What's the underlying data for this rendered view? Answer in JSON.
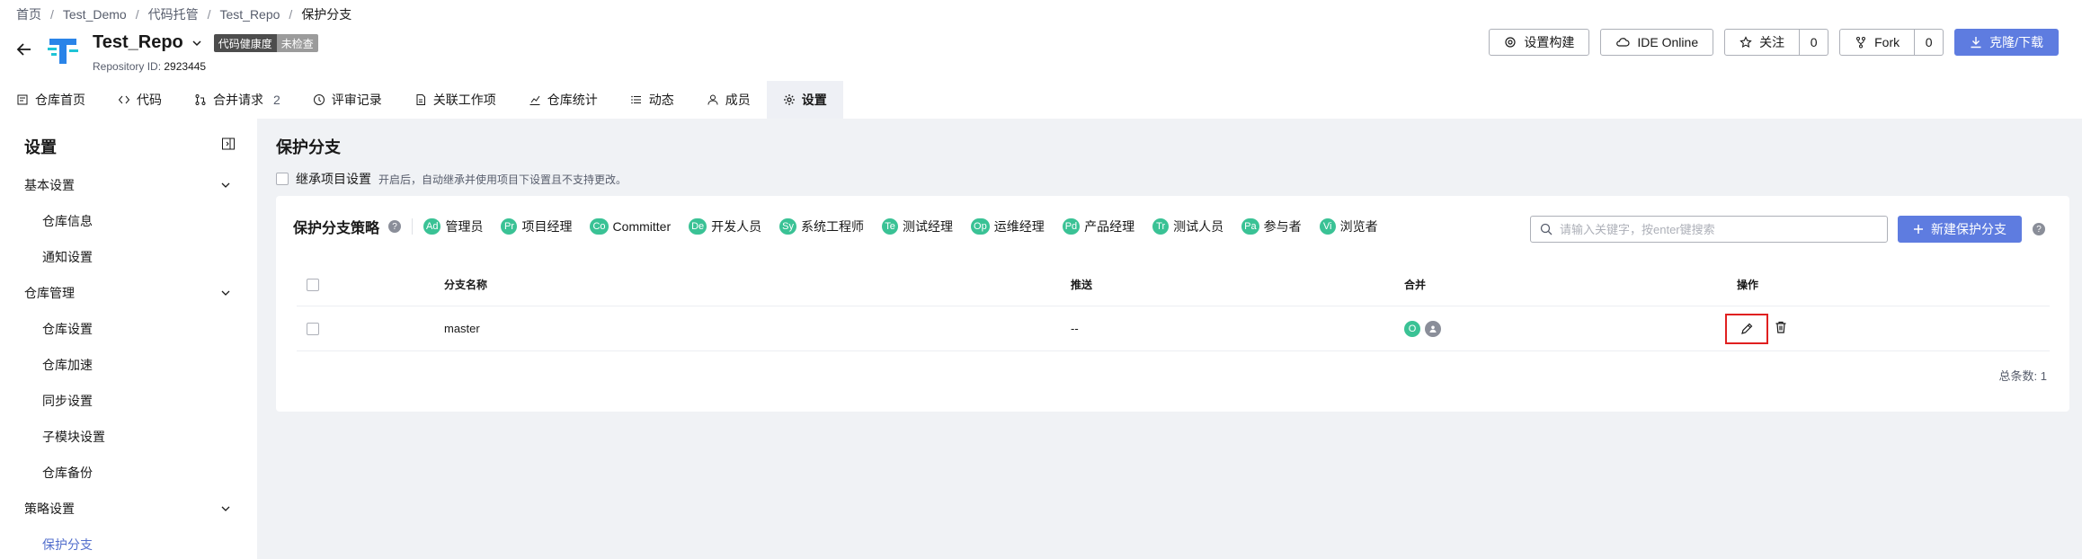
{
  "breadcrumb": [
    "首页",
    "Test_Demo",
    "代码托管",
    "Test_Repo",
    "保护分支"
  ],
  "repo": {
    "name": "Test_Repo",
    "health_label": "代码健康度",
    "health_status": "未检查",
    "id_label": "Repository ID:",
    "id_value": "2923445"
  },
  "actions": {
    "settings_build": "设置构建",
    "ide_online": "IDE Online",
    "follow": "关注",
    "follow_count": "0",
    "fork": "Fork",
    "fork_count": "0",
    "clone": "克隆/下载"
  },
  "tabs": [
    {
      "label": "仓库首页",
      "icon": "file-icon"
    },
    {
      "label": "代码",
      "icon": "code-icon"
    },
    {
      "label": "合并请求",
      "icon": "merge-request-icon",
      "badge": "2"
    },
    {
      "label": "评审记录",
      "icon": "review-icon"
    },
    {
      "label": "关联工作项",
      "icon": "link-work-item-icon"
    },
    {
      "label": "仓库统计",
      "icon": "stats-icon"
    },
    {
      "label": "动态",
      "icon": "activity-icon"
    },
    {
      "label": "成员",
      "icon": "member-icon"
    },
    {
      "label": "设置",
      "icon": "gear-icon",
      "active": true
    }
  ],
  "sidebar": {
    "title": "设置",
    "groups": [
      {
        "label": "基本设置",
        "items": [
          "仓库信息",
          "通知设置"
        ]
      },
      {
        "label": "仓库管理",
        "items": [
          "仓库设置",
          "仓库加速",
          "同步设置",
          "子模块设置",
          "仓库备份"
        ]
      },
      {
        "label": "策略设置",
        "items": [
          "保护分支"
        ]
      }
    ],
    "active_item": "保护分支"
  },
  "main": {
    "heading": "保护分支",
    "inherit_label": "继承项目设置",
    "inherit_desc": "开启后，自动继承并使用项目下设置且不支持更改。",
    "policy_title": "保护分支策略",
    "roles": [
      {
        "abbr": "Ad",
        "name": "管理员"
      },
      {
        "abbr": "Pr",
        "name": "项目经理"
      },
      {
        "abbr": "Co",
        "name": "Committer"
      },
      {
        "abbr": "De",
        "name": "开发人员"
      },
      {
        "abbr": "Sy",
        "name": "系统工程师"
      },
      {
        "abbr": "Te",
        "name": "测试经理"
      },
      {
        "abbr": "Op",
        "name": "运维经理"
      },
      {
        "abbr": "Pd",
        "name": "产品经理"
      },
      {
        "abbr": "Tr",
        "name": "测试人员"
      },
      {
        "abbr": "Pa",
        "name": "参与者"
      },
      {
        "abbr": "Vi",
        "name": "浏览者"
      }
    ],
    "search_placeholder": "请输入关键字，按enter键搜索",
    "new_button": "新建保护分支",
    "columns": {
      "name": "分支名称",
      "push": "推送",
      "merge": "合并",
      "ops": "操作"
    },
    "rows": [
      {
        "name": "master",
        "push": "--",
        "merge_badge": "O"
      }
    ],
    "total": "总条数: 1"
  },
  "colors": {
    "primary": "#5e7ce0",
    "role_badge": "#3ac295",
    "highlight": "#e02020"
  }
}
